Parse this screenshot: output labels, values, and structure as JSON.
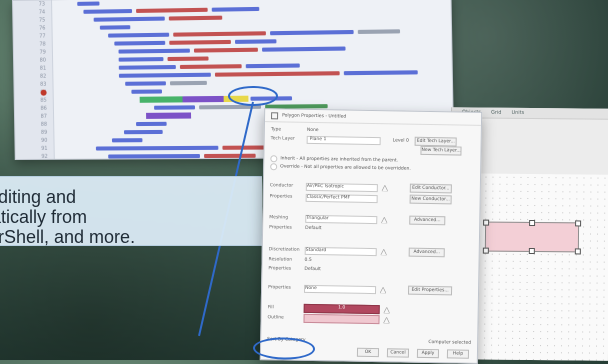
{
  "caption": {
    "line1": "diting and",
    "line2": "matically from",
    "line3": "rShell, and more."
  },
  "code_editor": {
    "line_numbers": [
      "73",
      "74",
      "75",
      "76",
      "77",
      "78",
      "79",
      "80",
      "81",
      "82",
      "83",
      "84",
      "85",
      "86",
      "87",
      "88",
      "89",
      "90",
      "91",
      "92"
    ]
  },
  "properties_panel": {
    "title": "Polygon Properties - Untitled",
    "fields": {
      "type_label": "Type",
      "type_value": "None",
      "tech_layer_label": "Tech Layer",
      "tech_layer_value": "Plane 1",
      "level_label": "Level 0",
      "edit_tech_layer": "Edit Tech Layer...",
      "new_tech_layer": "New Tech Layer..."
    },
    "inherit_text": "Inherit - All properties are inherited from the parent.",
    "override_text": "Override - Not all properties are allowed to be overridden.",
    "conductor_label": "Conductor",
    "conductor_value": "Air/PEC Isotropic",
    "edit_conductor": "Edit Conductor...",
    "properties_label": "Properties",
    "properties_value": "Classic/Perfect PMF",
    "new_conductor": "New Conductor...",
    "meshing_label": "Meshing",
    "meshing_value": "Triangular",
    "advanced_1": "Advanced...",
    "meshing_properties_label": "Properties",
    "meshing_properties_value": "Default",
    "discretization_label": "Discretization",
    "discretization_value": "Standard",
    "advanced_2": "Advanced...",
    "resolution_label": "Resolution",
    "resolution_value": "0.5",
    "dis_properties_label": "Properties",
    "dis_properties_value": "Default",
    "ports_label": "Properties",
    "ports_value": "None",
    "edit_properties": "Edit Properties...",
    "fill_label": "Fill",
    "fill_value": "1.0",
    "outline_label": "Outline",
    "sort_by_category": "Sort By Category",
    "computer_selected": "Computer selected",
    "buttons": [
      "OK",
      "Cancel",
      "Apply",
      "Help"
    ]
  },
  "right_panel": {
    "tabs": [
      "Objects",
      "Grid",
      "Units"
    ]
  },
  "colors": {
    "highlight_ellipse": "#2f69c9",
    "fill_swatch": "#b1475f",
    "shape_fill": "#f3cfd6"
  }
}
